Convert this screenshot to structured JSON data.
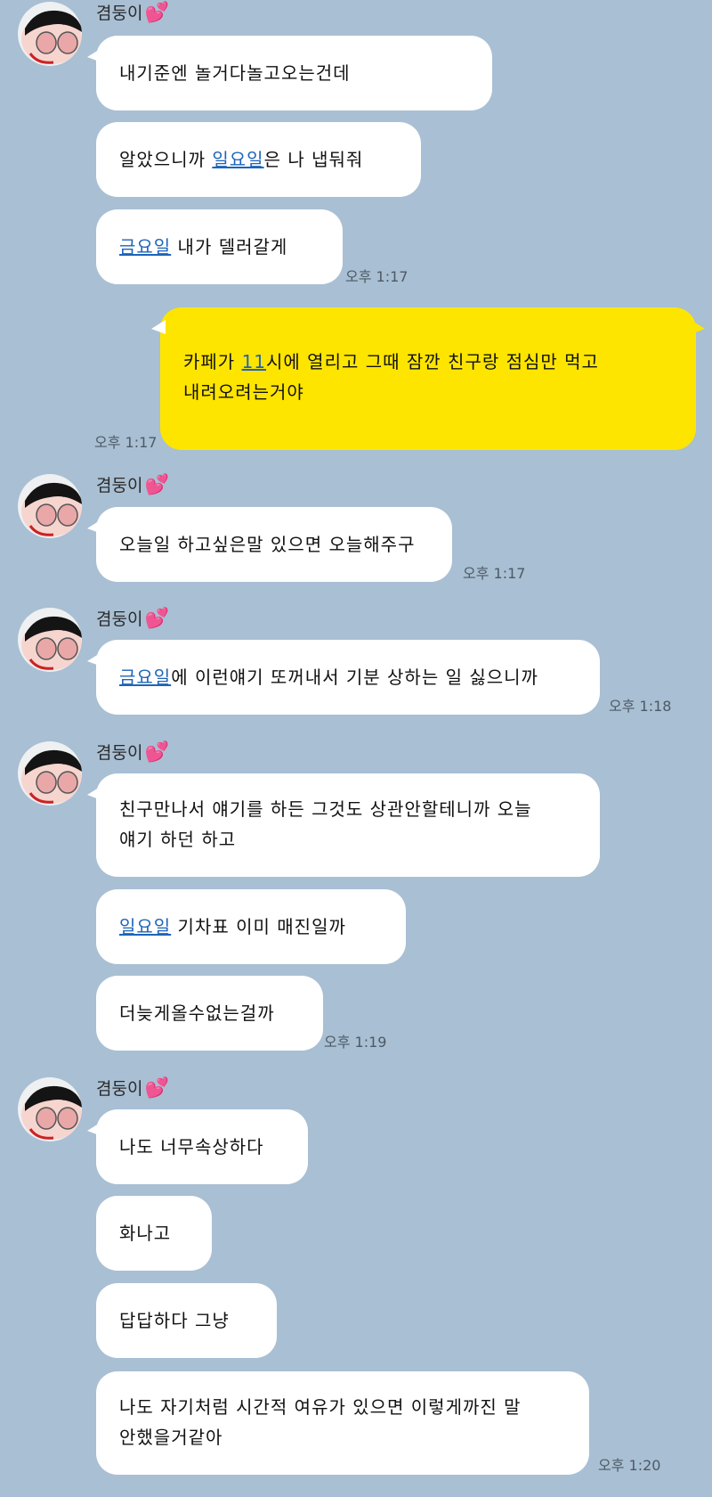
{
  "sender_name": "겸둥이",
  "heart_icon": "💕",
  "colors": {
    "background": "#a9bfd3",
    "my_bubble": "#fee500",
    "their_bubble": "#ffffff",
    "link": "#1d64b9"
  },
  "messages": [
    {
      "from": "them",
      "parts": [
        {
          "text": "내기준엔 놀거다놀고오는건데"
        }
      ]
    },
    {
      "from": "them",
      "parts": [
        {
          "text": "알았으니까 "
        },
        {
          "text": "일요일",
          "link": true
        },
        {
          "text": "은 나 냅둬줘"
        }
      ]
    },
    {
      "from": "them",
      "parts": [
        {
          "text": "금요일",
          "link": true
        },
        {
          "text": " 내가 델러갈게"
        }
      ],
      "time": "오후 1:17"
    },
    {
      "from": "me",
      "lines": [
        [
          {
            "text": "카페가 "
          },
          {
            "text": "11",
            "link": true
          },
          {
            "text": "시에 열리고 그때 잠깐 친구랑 점심만 먹고"
          }
        ],
        [
          {
            "text": "내려오려는거야"
          }
        ]
      ],
      "time": "오후 1:17"
    },
    {
      "from": "them",
      "parts": [
        {
          "text": "오늘일 하고싶은말 있으면 오늘해주구"
        }
      ],
      "time": "오후 1:17"
    },
    {
      "from": "them",
      "parts": [
        {
          "text": "금요일",
          "link": true
        },
        {
          "text": "에 이런얘기 또꺼내서 기분 상하는 일 싫으니까"
        }
      ],
      "time": "오후 1:18"
    },
    {
      "from": "them",
      "lines": [
        [
          {
            "text": "친구만나서 얘기를 하든 그것도 상관안할테니까 오늘"
          }
        ],
        [
          {
            "text": "얘기 하던 하고"
          }
        ]
      ]
    },
    {
      "from": "them",
      "parts": [
        {
          "text": "일요일",
          "link": true
        },
        {
          "text": " 기차표 이미 매진일까"
        }
      ]
    },
    {
      "from": "them",
      "parts": [
        {
          "text": "더늦게올수없는걸까"
        }
      ],
      "time": "오후 1:19"
    },
    {
      "from": "them",
      "parts": [
        {
          "text": "나도 너무속상하다"
        }
      ]
    },
    {
      "from": "them",
      "parts": [
        {
          "text": "화나고"
        }
      ]
    },
    {
      "from": "them",
      "parts": [
        {
          "text": "답답하다 그냥"
        }
      ]
    },
    {
      "from": "them",
      "lines": [
        [
          {
            "text": "나도 자기처럼 시간적 여유가 있으면 이렇게까진 말"
          }
        ],
        [
          {
            "text": "안했을거같아"
          }
        ]
      ],
      "time": "오후 1:20"
    }
  ]
}
